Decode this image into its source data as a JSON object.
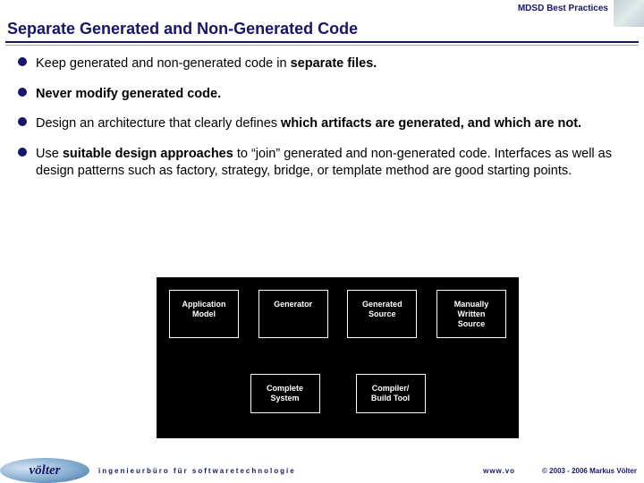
{
  "header": {
    "topic": "MDSD Best Practices"
  },
  "title": "Separate Generated and Non-Generated Code",
  "bullets": [
    {
      "pre": "Keep generated and non-generated code in ",
      "bold1": "separate files.",
      "post": ""
    },
    {
      "pre": "",
      "bold1": "Never modify generated code.",
      "post": ""
    },
    {
      "pre": "Design an architecture that clearly defines ",
      "bold1": "which artifacts are generated, and which are not.",
      "post": ""
    },
    {
      "pre": "Use ",
      "bold1": "suitable design approaches",
      "post": " to “join” generated and non-generated code. Interfaces as well as design patterns such as factory, strategy, bridge, or template method are good starting points."
    }
  ],
  "diagram": {
    "top": [
      "Application\nModel",
      "Generator",
      "Generated\nSource",
      "Manually\nWritten\nSource"
    ],
    "bottom": [
      "Complete\nSystem",
      "Compiler/\nBuild Tool"
    ]
  },
  "footer": {
    "logo": "völter",
    "tagline": "ingenieurbüro für softwaretechnologie",
    "url": "www.vo",
    "copyright": "© 2003 - 2006 Markus Völter"
  }
}
